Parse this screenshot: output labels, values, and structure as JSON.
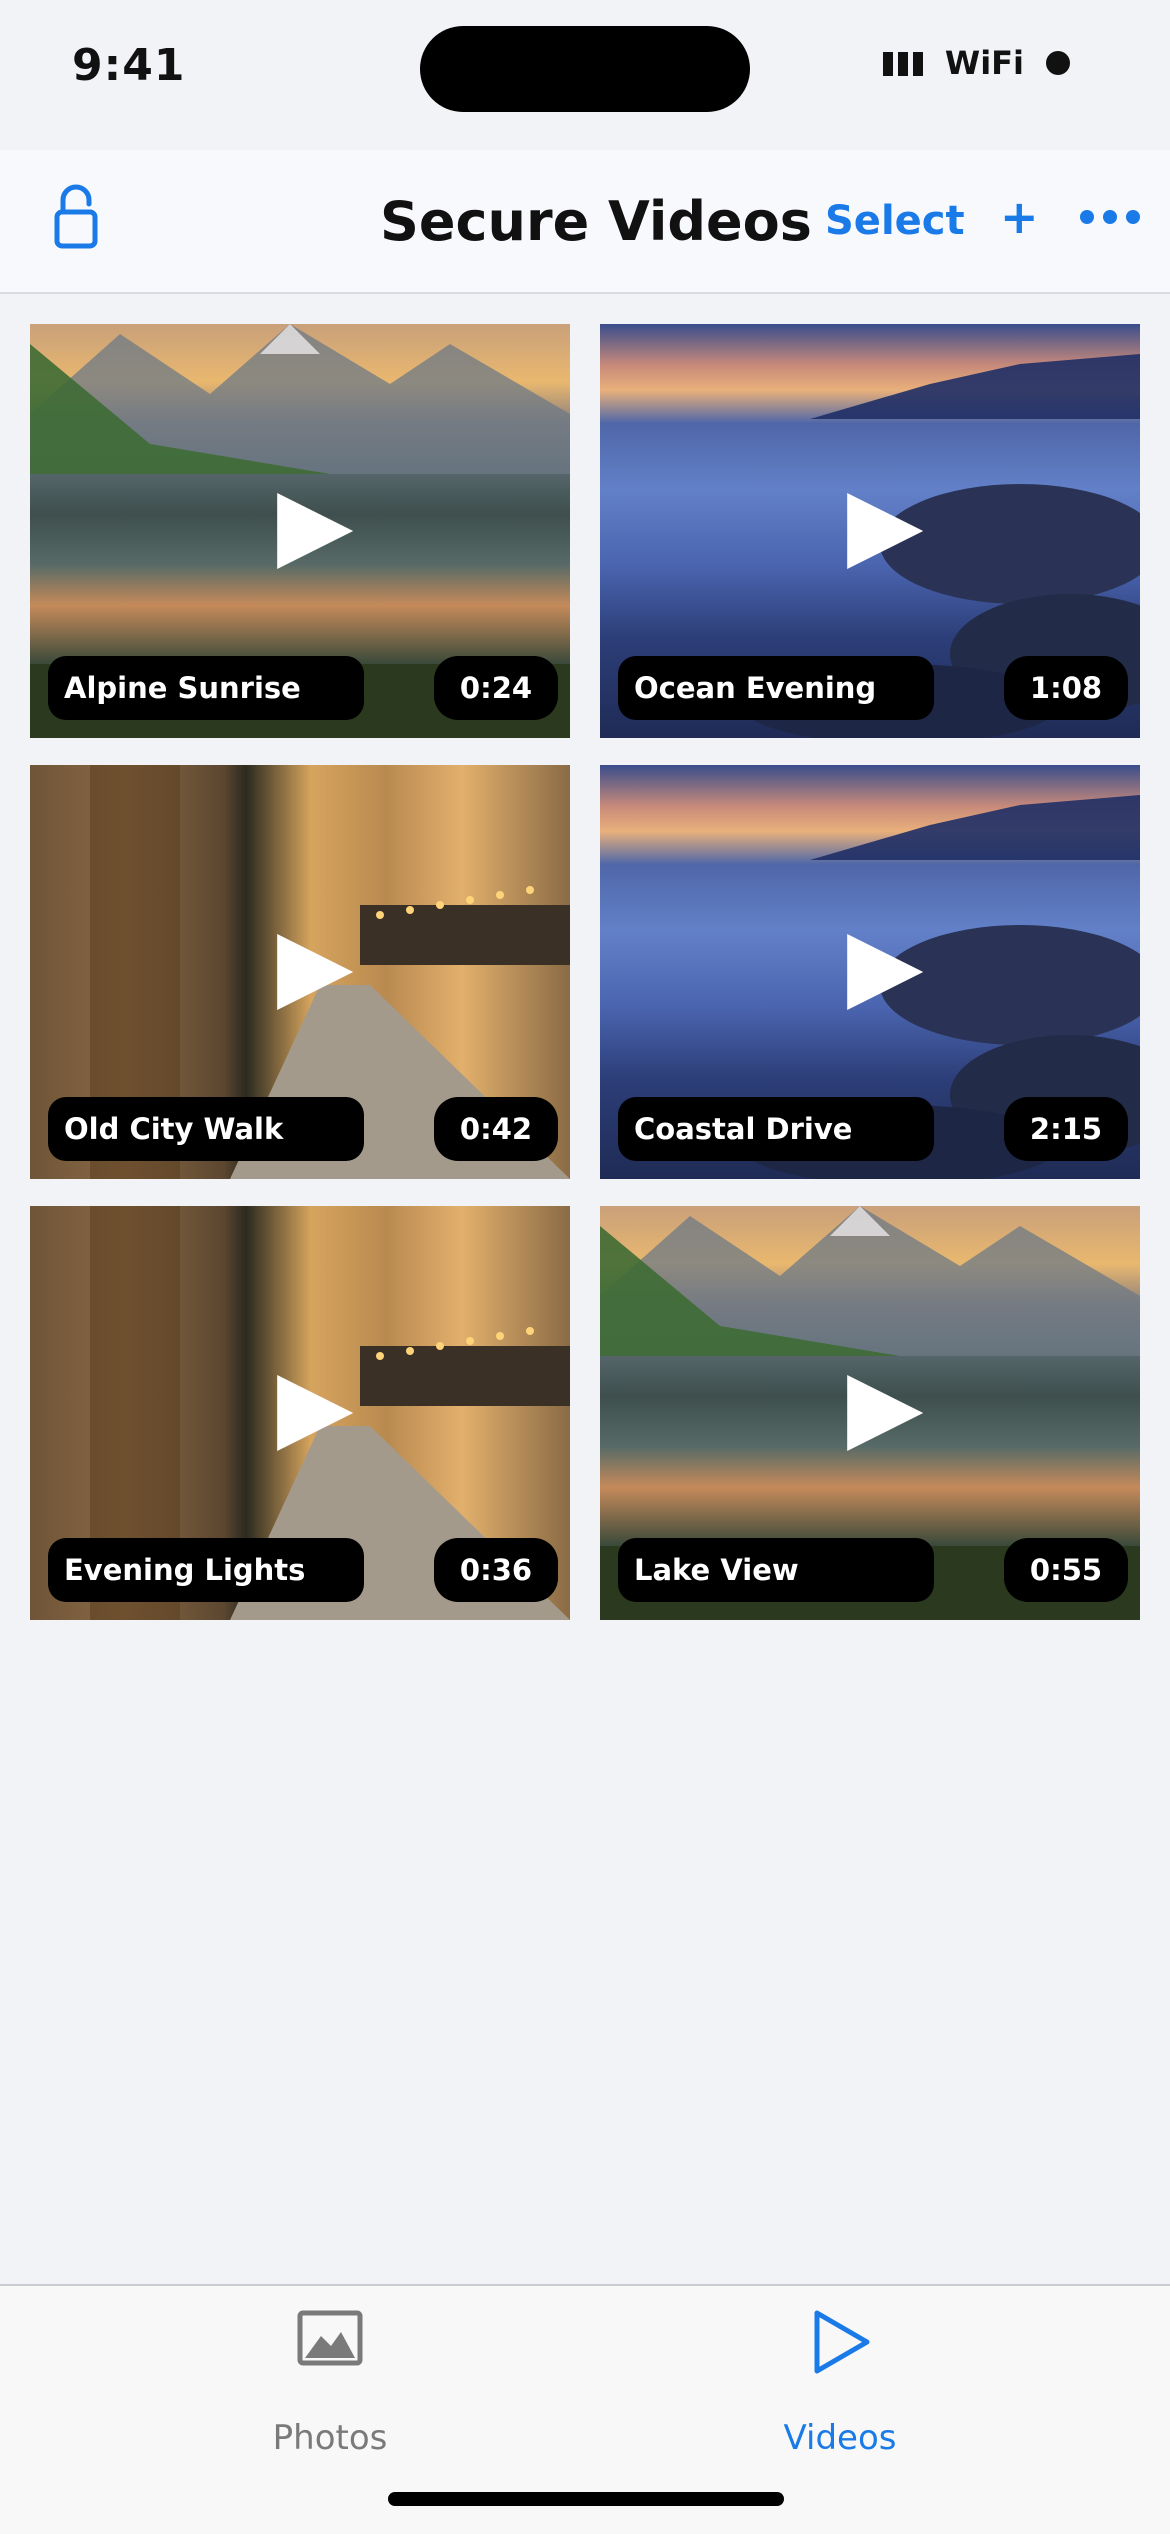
{
  "status_bar": {
    "time": "9:41",
    "wifi": "WiFi"
  },
  "nav": {
    "title": "Secure Videos",
    "select_label": "Select",
    "add_label": "+",
    "lock_icon": "lock-icon",
    "more_icon": "ellipsis-icon"
  },
  "videos": [
    {
      "title": "Alpine Sunrise",
      "duration": "0:24"
    },
    {
      "title": "Ocean Evening",
      "duration": "1:08"
    },
    {
      "title": "Old City Walk",
      "duration": "0:42"
    },
    {
      "title": "Coastal Drive",
      "duration": "2:15"
    },
    {
      "title": "Evening Lights",
      "duration": "0:36"
    },
    {
      "title": "Lake View",
      "duration": "0:55"
    }
  ],
  "tabs": [
    {
      "label": "Photos",
      "icon": "photo-icon",
      "selected": false
    },
    {
      "label": "Videos",
      "icon": "play-icon",
      "selected": true
    }
  ],
  "colors": {
    "accent": "#1a7ae8",
    "inactive": "#7a7a7a",
    "background": "#f2f3f7"
  }
}
